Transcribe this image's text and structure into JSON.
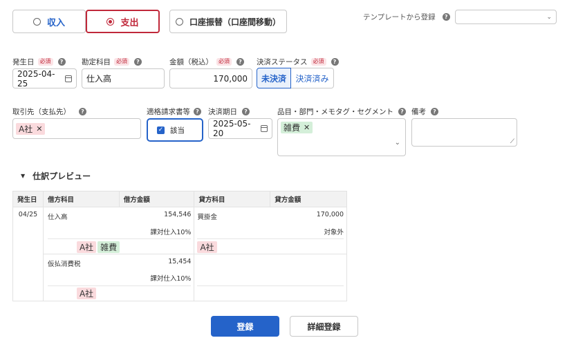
{
  "type_tabs": [
    {
      "label": "収入",
      "selected": false
    },
    {
      "label": "支出",
      "selected": true
    },
    {
      "label": "口座振替（口座間移動）",
      "selected": false
    }
  ],
  "template": {
    "label": "テンプレートから登録",
    "value": ""
  },
  "required_badge": "必須",
  "help_glyph": "?",
  "fields": {
    "date": {
      "label": "発生日",
      "value": "2025-04-25"
    },
    "account": {
      "label": "勘定科目",
      "value": "仕入高"
    },
    "amount": {
      "label": "金額（税込）",
      "value": "170,000"
    },
    "status": {
      "label": "決済ステータス",
      "options": [
        "未決済",
        "決済済み"
      ],
      "selected": "未決済"
    },
    "partner": {
      "label": "取引先（支払先）",
      "tag": "A社"
    },
    "invoice": {
      "label": "適格請求書等",
      "checkbox_label": "該当",
      "checked": true
    },
    "due": {
      "label": "決済期日",
      "value": "2025-05-20"
    },
    "item": {
      "label": "品目・部門・メモタグ・セグメント",
      "tag": "雑費"
    },
    "memo": {
      "label": "備考",
      "value": ""
    }
  },
  "preview": {
    "title": "仕訳プレビュー",
    "headers": [
      "発生日",
      "借方科目",
      "借方金額",
      "貸方科目",
      "貸方金額"
    ],
    "date": "04/25",
    "rows": [
      {
        "debit_account": "仕入高",
        "debit_amount": "154,546",
        "debit_tax": "課対仕入10%",
        "credit_account": "買掛金",
        "credit_amount": "170,000",
        "credit_tax": "対象外",
        "debit_tags": [
          "A社",
          "雑費"
        ],
        "credit_tags": [
          "A社"
        ]
      },
      {
        "debit_account": "仮払消費税",
        "debit_amount": "15,454",
        "debit_tax": "課対仕入10%",
        "credit_account": "",
        "credit_amount": "",
        "credit_tax": "",
        "debit_tags": [
          "A社"
        ],
        "credit_tags": []
      }
    ]
  },
  "buttons": {
    "submit": "登録",
    "detail": "詳細登録"
  },
  "colors": {
    "accent_blue": "#2563c9",
    "accent_red": "#c0283a",
    "tag_pink": "#fadadd",
    "tag_green": "#d4efd9"
  }
}
